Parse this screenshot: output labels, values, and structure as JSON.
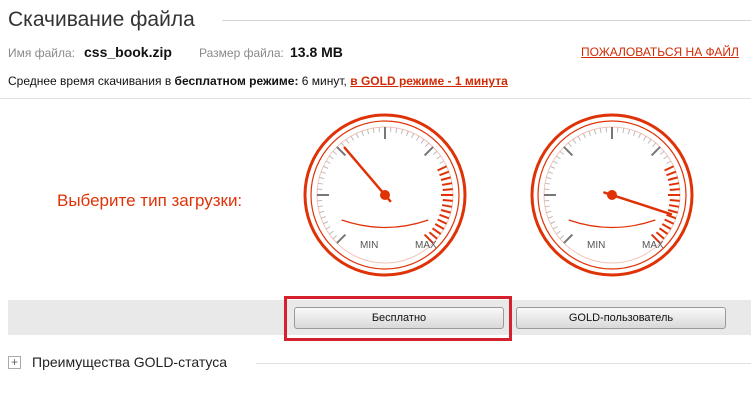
{
  "header": {
    "title": "Скачивание файла"
  },
  "file": {
    "name_label": "Имя файла:",
    "name_value": "css_book.zip",
    "size_label": "Размер файла:",
    "size_value": "13.8 MB",
    "complain_link": "ПОЖАЛОВАТЬСЯ НА ФАЙЛ"
  },
  "avg_time": {
    "prefix": "Среднее время скачивания в ",
    "free_mode": "бесплатном режиме:",
    "free_time": " 6 минут, ",
    "gold_link": "в GOLD режиме - 1 минута"
  },
  "choose_label": "Выберите тип загрузки:",
  "gauges": [
    {
      "min_label": "MIN",
      "max_label": "MAX",
      "needle_level": 0.35
    },
    {
      "min_label": "MIN",
      "max_label": "MAX",
      "needle_level": 0.9
    }
  ],
  "buttons": {
    "free": "Бесплатно",
    "gold": "GOLD-пользователь"
  },
  "advantages": {
    "toggle": "+",
    "label": "Преимущества GOLD-статуса"
  },
  "colors": {
    "accent": "#e03207",
    "link": "#d12b06",
    "highlight": "#d4212d"
  }
}
